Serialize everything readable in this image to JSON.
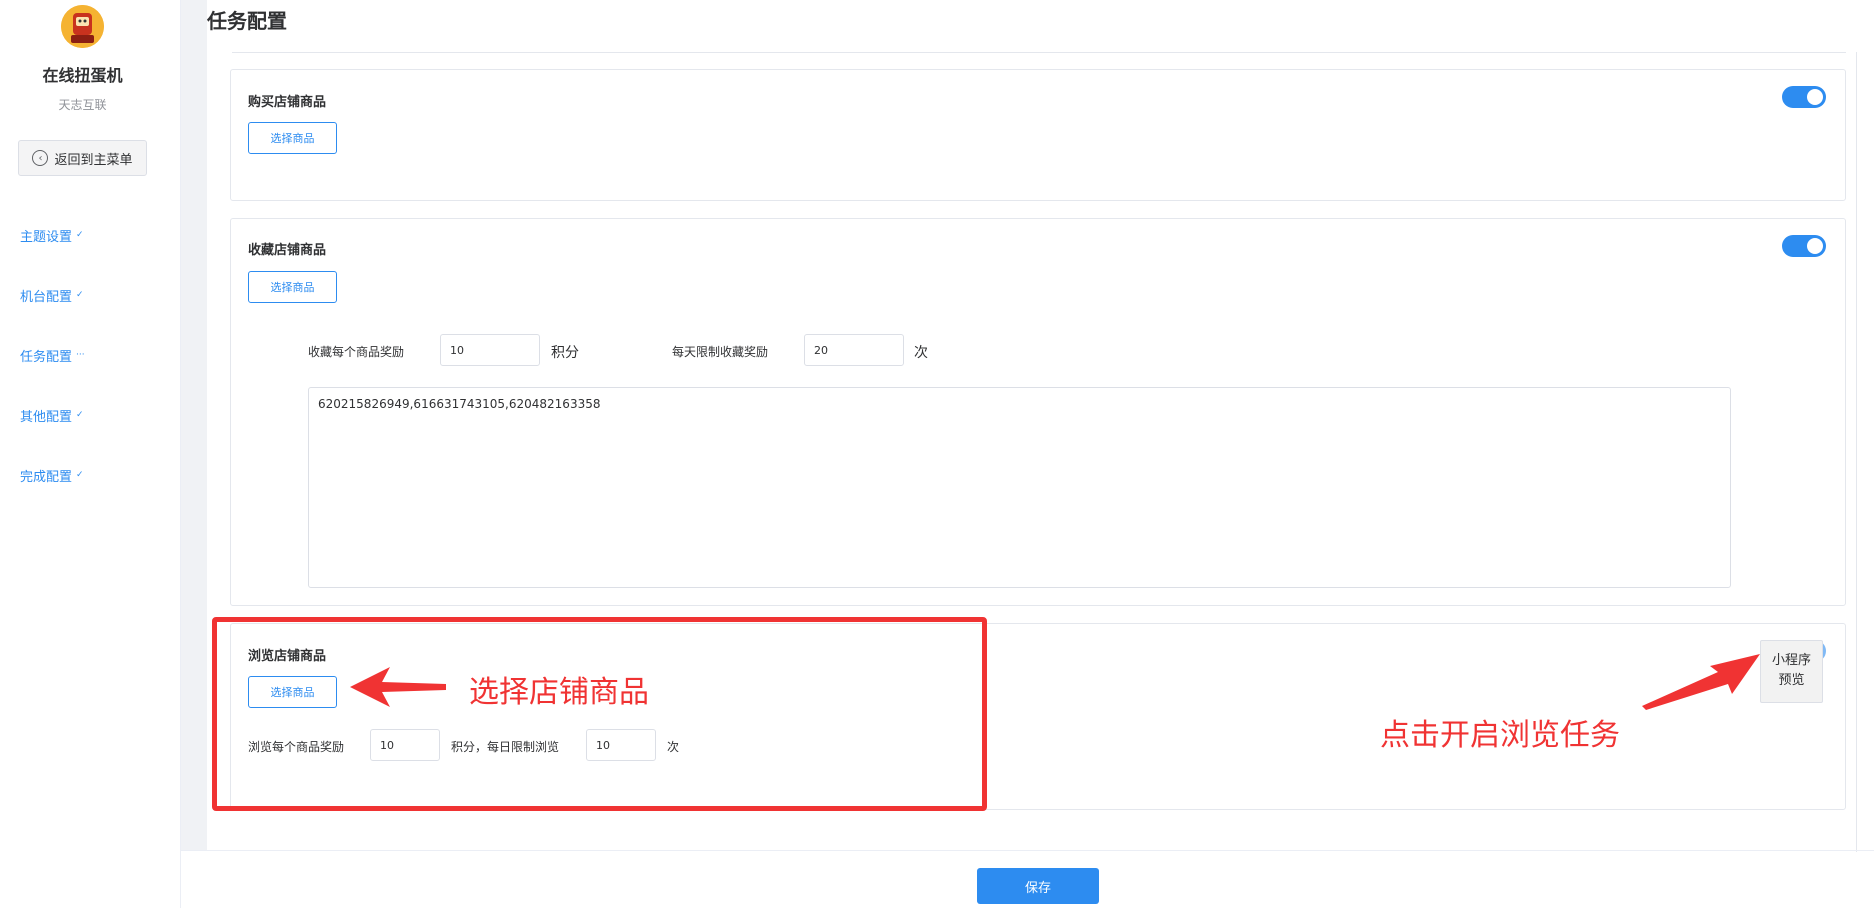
{
  "sidebar": {
    "shop_name": "在线扭蛋机",
    "shop_sub": "天志互联",
    "back_label": "返回到主菜单",
    "menu": [
      {
        "label": "主题设置",
        "marker": "✓"
      },
      {
        "label": "机台配置",
        "marker": "✓"
      },
      {
        "label": "任务配置",
        "marker": "···"
      },
      {
        "label": "其他配置",
        "marker": "✓"
      },
      {
        "label": "完成配置",
        "marker": "✓"
      }
    ]
  },
  "page": {
    "title": "任务配置"
  },
  "cards": {
    "buy": {
      "title": "购买店铺商品",
      "select_label": "选择商品",
      "enabled": true
    },
    "favorite": {
      "title": "收藏店铺商品",
      "select_label": "选择商品",
      "enabled": true,
      "reward_label": "收藏每个商品奖励",
      "reward_value": "10",
      "reward_unit": "积分",
      "limit_label": "每天限制收藏奖励",
      "limit_value": "20",
      "limit_unit": "次",
      "goods_ids": "620215826949,616631743105,620482163358"
    },
    "browse": {
      "title": "浏览店铺商品",
      "select_label": "选择商品",
      "enabled": true,
      "reward_label": "浏览每个商品奖励",
      "reward_value": "10",
      "middle_label": "积分，每日限制浏览",
      "limit_value": "10",
      "limit_unit": "次"
    }
  },
  "annotations": {
    "select_goods": "选择店铺商品",
    "enable_browse": "点击开启浏览任务"
  },
  "preview": {
    "line1": "小程序",
    "line2": "预览"
  },
  "footer": {
    "save_label": "保存"
  },
  "colors": {
    "primary": "#2d8cf0",
    "annotation_red": "#f03333"
  }
}
